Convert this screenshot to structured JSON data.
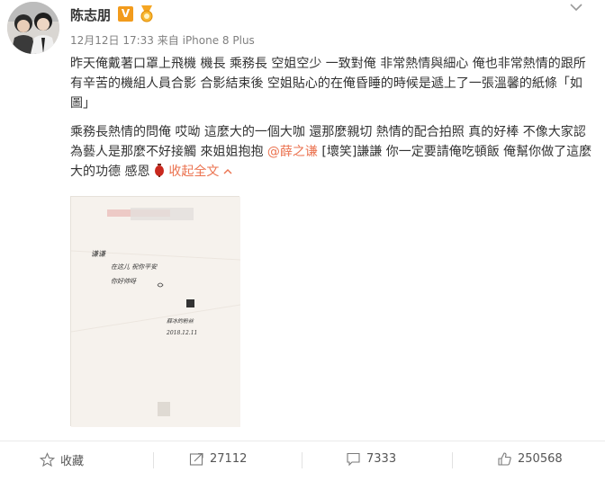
{
  "user": {
    "name": "陈志朋",
    "verified_badge": "V",
    "timestamp": "12月12日 17:33",
    "source_prefix": "来自",
    "source": "iPhone 8 Plus"
  },
  "post": {
    "paragraph1": "昨天俺戴著口罩上飛機 機長 乘務長 空姐空少 一致對俺 非常熱情與細心 俺也非常熱情的跟所有辛苦的機組人員合影 合影結束後 空姐貼心的在俺昏睡的時候是遞上了一張溫馨的紙條「如圖」",
    "paragraph2_before_mention": "乘務長熱情的問俺 哎呦 這麼大的一個大咖 還那麼親切 熱情的配合拍照 真的好棒 不像大家認為藝人是那麼不好接觸 來姐姐抱抱 ",
    "mention": "@薛之谦",
    "emoji_text": " [壞笑]",
    "paragraph2_after": "謙謙 你一定要請俺吃頓飯 俺幫你做了這麼大的功德 感恩",
    "collapse_label": "收起全文",
    "note_image": {
      "line1": "谦谦",
      "line2": "在这儿 祝你平安",
      "line3": "你好帅呀",
      "signature": "薛冰的粉丝",
      "date": "2018.12.11"
    }
  },
  "footer": {
    "favorite_label": "收藏",
    "repost_count": "27112",
    "comment_count": "7333",
    "like_count": "250568"
  },
  "colors": {
    "link": "#eb7350",
    "badge": "#f29b1c",
    "meta": "#808080"
  },
  "icons": {
    "favorite": "star-icon",
    "repost": "repost-icon",
    "comment": "comment-icon",
    "like": "thumbs-up-icon",
    "expand": "chevron-down-icon",
    "collapse": "chevron-up-icon"
  }
}
